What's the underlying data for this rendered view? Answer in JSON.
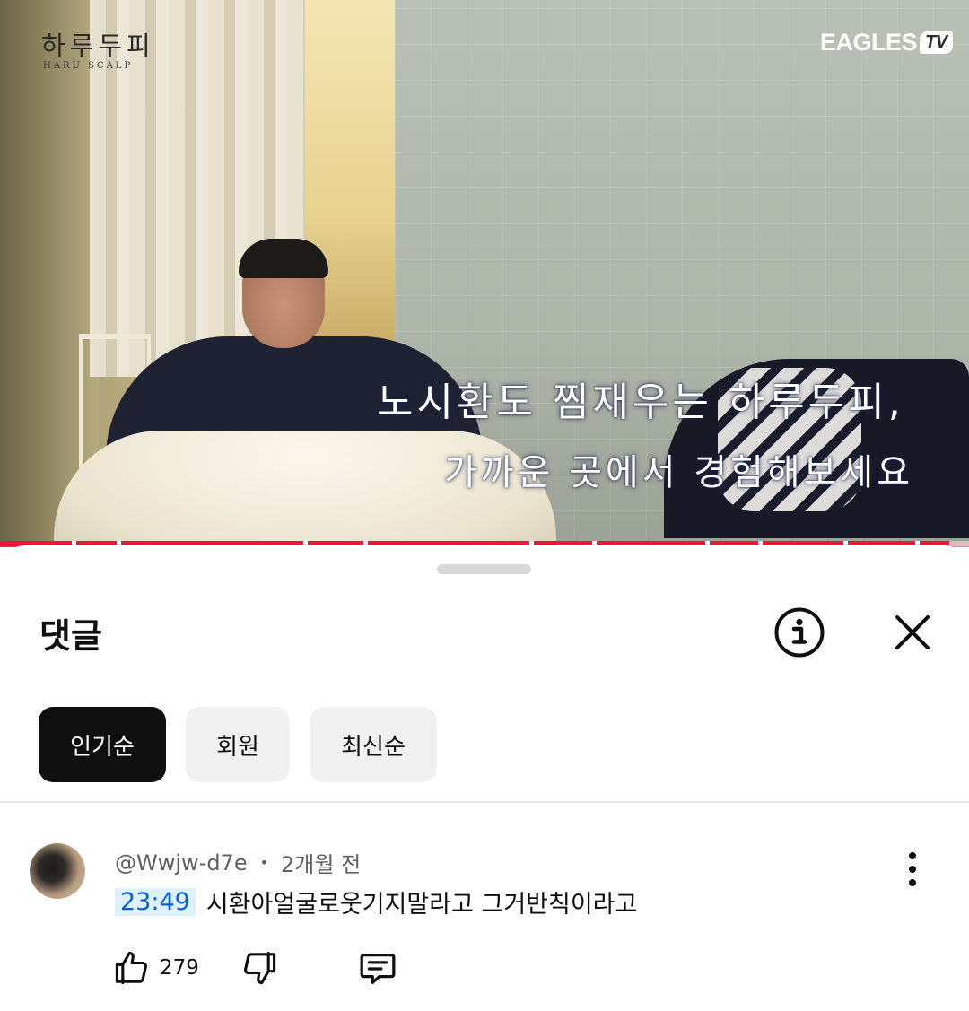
{
  "video": {
    "brand_korean": "하루두피",
    "brand_english": "HARU SCALP",
    "channel_logo": "EAGLES",
    "channel_logo_tv": "TV",
    "subtitle_line1": "노시환도 찜재우는 하루두피,",
    "subtitle_line2": "가까운 곳에서 경험해보세요",
    "progress_played_fraction": 0.98
  },
  "comments_sheet": {
    "title": "댓글",
    "info_icon": "info-circle-icon",
    "close_icon": "close-icon",
    "filters": [
      {
        "label": "인기순",
        "active": true
      },
      {
        "label": "회원",
        "active": false
      },
      {
        "label": "최신순",
        "active": false
      }
    ]
  },
  "comments": [
    {
      "author": "@Wwjw-d7e",
      "separator": "•",
      "age": "2개월 전",
      "timestamp_link": "23:49",
      "text": "시환아얼굴로웃기지말라고 그거반칙이라고",
      "likes": "279"
    }
  ],
  "colors": {
    "progress_red": "#e8173c",
    "timestamp_blue": "#065fd4",
    "timestamp_bg": "#def1ff",
    "active_chip": "#0f0f0f"
  }
}
